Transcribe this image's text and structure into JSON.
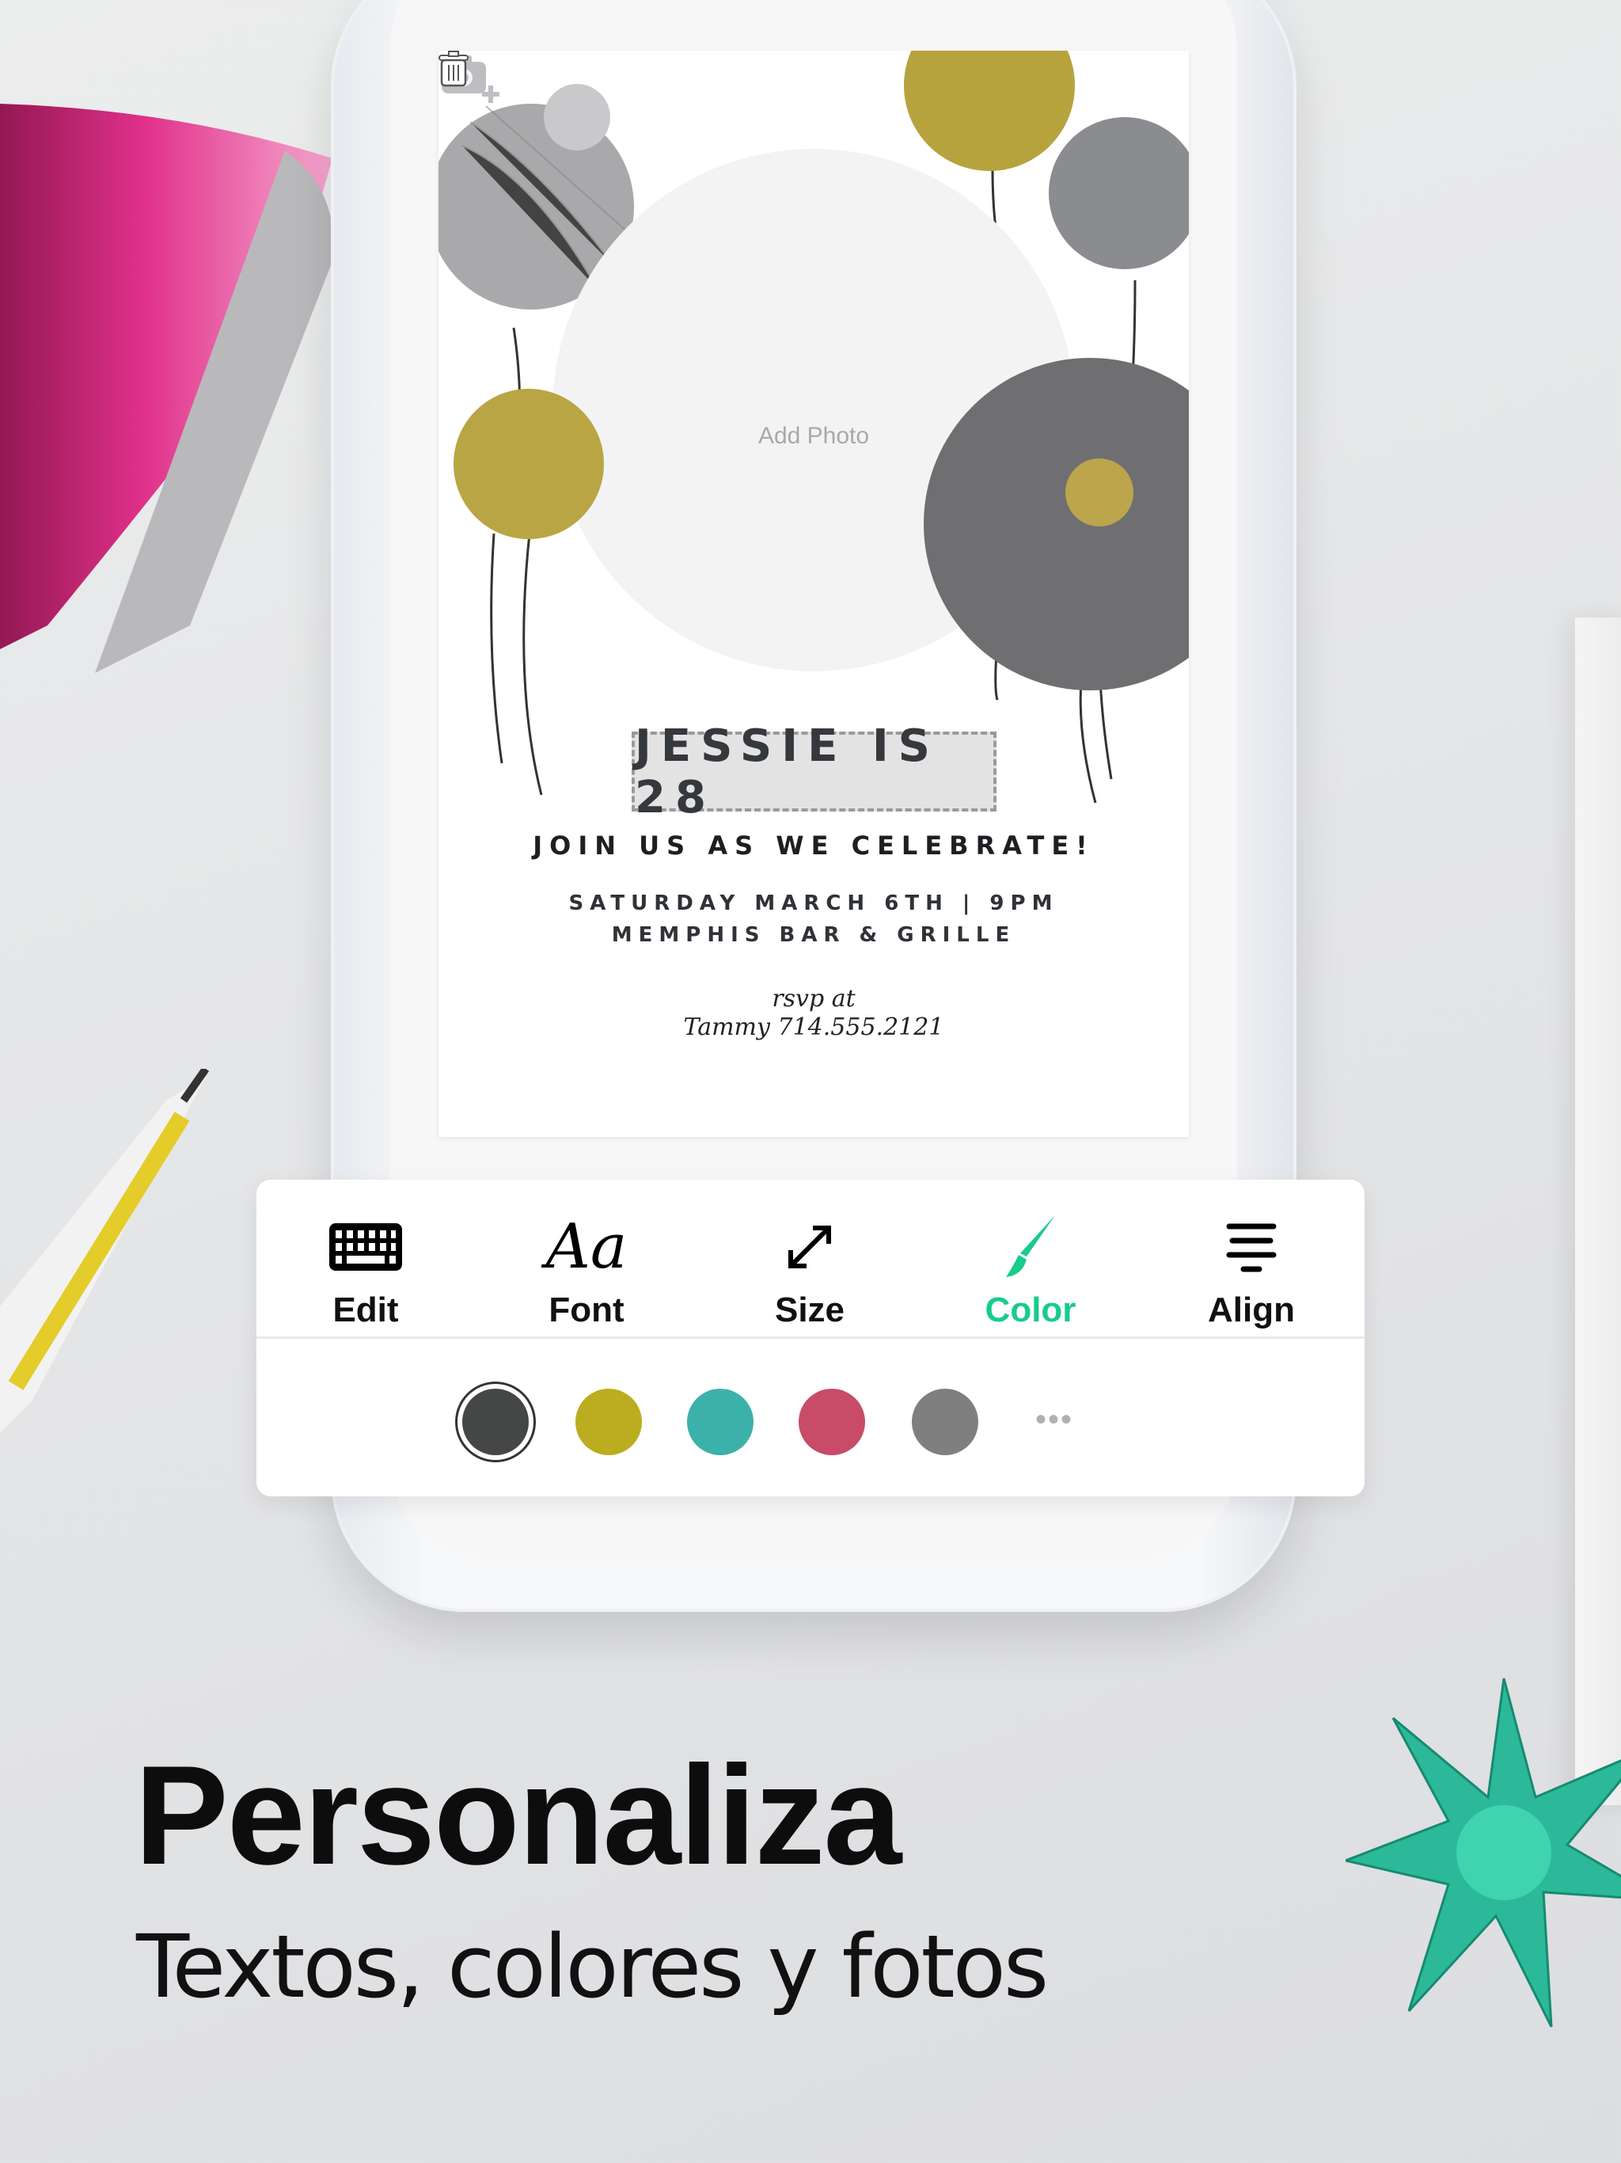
{
  "invitation": {
    "add_photo_label": "Add Photo",
    "title": "JESSIE IS 28",
    "subtitle": "JOIN US AS WE CELEBRATE!",
    "date_line": "SATURDAY MARCH 6TH | 9PM",
    "venue_line": "MEMPHIS BAR & GRILLE",
    "rsvp_line": "rsvp at",
    "contact_line": "Tammy 714.555.2121"
  },
  "toolbar": {
    "active_tab": "Color",
    "accent_color": "#18cc8a",
    "tabs": [
      {
        "label": "Edit",
        "icon": "keyboard-icon"
      },
      {
        "label": "Font",
        "icon": "font-aa-icon"
      },
      {
        "label": "Size",
        "icon": "resize-arrow-icon"
      },
      {
        "label": "Color",
        "icon": "paintbrush-icon"
      },
      {
        "label": "Align",
        "icon": "align-center-icon"
      }
    ],
    "swatches": [
      {
        "color": "#454646",
        "selected": true
      },
      {
        "color": "#bbad1f",
        "selected": false
      },
      {
        "color": "#3cb1aa",
        "selected": false
      },
      {
        "color": "#c84b68",
        "selected": false
      },
      {
        "color": "#7f7f7f",
        "selected": false
      }
    ],
    "more_label": "•••"
  },
  "promo": {
    "headline": "Personaliza",
    "subheadline": "Textos, colores y fotos"
  }
}
